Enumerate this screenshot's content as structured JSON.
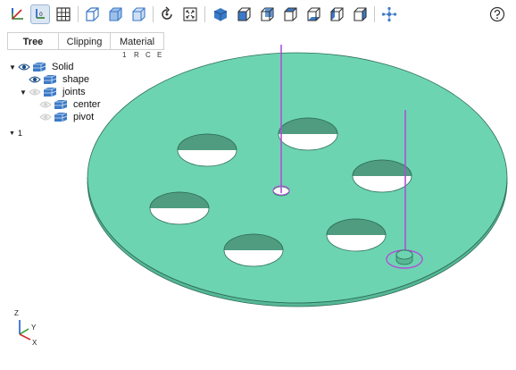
{
  "toolbar": {
    "buttons": [
      {
        "name": "axes-toggle-icon"
      },
      {
        "name": "axes-origin-toggle-icon"
      },
      {
        "name": "grid-toggle-icon"
      },
      {
        "name": "perspective-icon"
      },
      {
        "name": "transparent-icon"
      },
      {
        "name": "black-edges-icon"
      },
      {
        "name": "reset-view-icon"
      },
      {
        "name": "zoom-fit-icon"
      },
      {
        "name": "view-iso-icon"
      },
      {
        "name": "view-front-icon"
      },
      {
        "name": "view-rear-icon"
      },
      {
        "name": "view-top-icon"
      },
      {
        "name": "view-bottom-icon"
      },
      {
        "name": "view-left-icon"
      },
      {
        "name": "view-right-icon"
      },
      {
        "name": "explode-icon"
      },
      {
        "name": "help-icon"
      }
    ]
  },
  "tabs": [
    {
      "label": "Tree",
      "active": true
    },
    {
      "label": "Clipping",
      "active": false
    },
    {
      "label": "Material",
      "active": false
    }
  ],
  "tree_columns": [
    "1",
    "R",
    "C",
    "E"
  ],
  "tree": [
    {
      "label": "Solid"
    },
    {
      "label": "shape"
    },
    {
      "label": "joints"
    },
    {
      "label": "center"
    },
    {
      "label": "pivot"
    }
  ],
  "collapsed_node_label": "1",
  "axes_labels": {
    "z": "Z",
    "y": "Y",
    "x": "X"
  },
  "colors": {
    "part_fill": "#6dd4b1",
    "part_edge": "#2f6f5a",
    "joint_line": "#b04fd8",
    "accent_blue": "#3b7ac8"
  }
}
